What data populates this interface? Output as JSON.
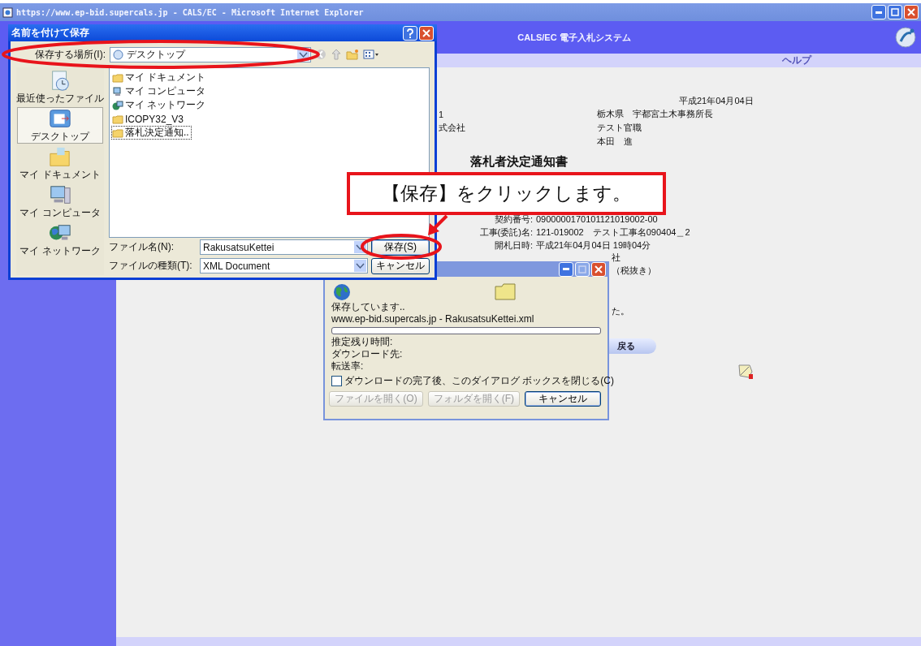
{
  "browser": {
    "title": "https://www.ep-bid.supercals.jp - CALS/EC - Microsoft Internet Explorer"
  },
  "site": {
    "header": "CALS/EC 電子入札システム",
    "help_link": "ヘルプ"
  },
  "document": {
    "date": "平成21年04月04日",
    "address_rows": [
      {
        "column_1": "1",
        "column_2": "栃木県　宇都宮土木事務所長"
      },
      {
        "column_1": "式会社",
        "column_2": "テスト官職"
      },
      {
        "column_1": "",
        "column_2": "本田　進"
      }
    ],
    "title": "落札者決定通知書",
    "fields": [
      {
        "label": "契約番号:",
        "value": "0900000170101121019002-00"
      },
      {
        "label": "工事(委託)名:",
        "value": "121-019002　テスト工事名090404＿2"
      },
      {
        "label": "開札日時:",
        "value": "平成21年04月04日 19時04分"
      }
    ],
    "fragments": [
      "社",
      "（税抜き）"
    ],
    "fragment_after": "た。",
    "back_button": "戻る"
  },
  "save_dialog": {
    "title": "名前を付けて保存",
    "location_label": "保存する場所(I):",
    "location": "デスクトップ",
    "places": [
      {
        "label": "最近使ったファイル",
        "kind": "recent",
        "selected": false
      },
      {
        "label": "デスクトップ",
        "kind": "desktop",
        "selected": true
      },
      {
        "label": "マイ ドキュメント",
        "kind": "documents",
        "selected": false
      },
      {
        "label": "マイ コンピュータ",
        "kind": "computer",
        "selected": false
      },
      {
        "label": "マイ ネットワーク",
        "kind": "network",
        "selected": false
      }
    ],
    "files": [
      {
        "name": "マイ ドキュメント",
        "kind": "folder",
        "selected": false
      },
      {
        "name": "マイ コンピュータ",
        "kind": "computer",
        "selected": false
      },
      {
        "name": "マイ ネットワーク",
        "kind": "network",
        "selected": false
      },
      {
        "name": "ICOPY32_V3",
        "kind": "folder",
        "selected": false
      },
      {
        "name": "落札決定通知..",
        "kind": "folder",
        "selected": true
      }
    ],
    "filename_label": "ファイル名(N):",
    "filename": "RakusatsuKettei",
    "filetype_label": "ファイルの種類(T):",
    "filetype": "XML Document",
    "save_button": "保存(S)",
    "cancel_button": "キャンセル"
  },
  "download_dialog": {
    "status": "保存しています..",
    "source": "www.ep-bid.supercals.jp - RakusatsuKettei.xml",
    "level": 0,
    "info_rows": [
      "推定残り時間:",
      "ダウンロード先:",
      "転送率:"
    ],
    "close_option": {
      "label": "ダウンロードの完了後、このダイアログ ボックスを閉じる(C)",
      "checked": false
    },
    "buttons": [
      {
        "label": "ファイルを開く(O)",
        "disabled": true
      },
      {
        "label": "フォルダを開く(F)",
        "disabled": true
      },
      {
        "label": "キャンセル",
        "disabled": false
      }
    ]
  },
  "callout": {
    "text": "【保存】をクリックします。"
  }
}
